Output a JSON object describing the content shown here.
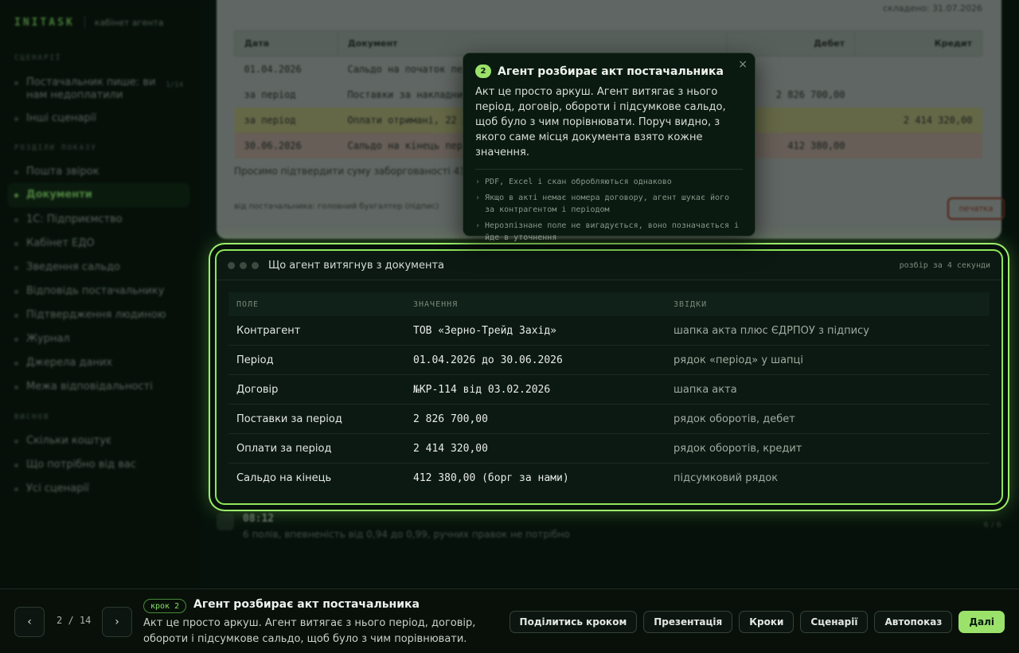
{
  "sidebar": {
    "brand": "INITASK",
    "brand_sub": "кабінет агента",
    "sections": [
      "СЦЕНАРІЇ",
      "РОЗДІЛИ ПОКАЗУ",
      "ВИСНОВ"
    ],
    "scenario_items": [
      {
        "label": "Постачальник пише: ви нам недоплатили",
        "count": "1/14"
      },
      {
        "label": "Інші сценарії"
      }
    ],
    "show_items": [
      {
        "label": "Пошта звірок"
      },
      {
        "label": "Документи",
        "active": true
      },
      {
        "label": "1С: Підприємство"
      },
      {
        "label": "Кабінет ЕДО"
      },
      {
        "label": "Зведення сальдо"
      },
      {
        "label": "Відповідь постачальнику"
      },
      {
        "label": "Підтвердження людиною"
      },
      {
        "label": "Журнал"
      },
      {
        "label": "Джерела даних"
      },
      {
        "label": "Межа відповідальності"
      }
    ],
    "conclusion_items": [
      {
        "label": "Скільки коштує"
      },
      {
        "label": "Що потрібно від вас"
      },
      {
        "label": "Усі сценарії"
      }
    ]
  },
  "document": {
    "composed": "складено: 31.07.2026",
    "headers": [
      "Дата",
      "Документ",
      "Дебет",
      "Кредит"
    ],
    "rows": [
      {
        "date": "01.04.2026",
        "doc": "Сальдо на початок періоду",
        "debit": "",
        "credit": ""
      },
      {
        "date": "за період",
        "doc": "Поставки за накладними",
        "debit": "2 826 700,00",
        "credit": ""
      },
      {
        "date": "за період",
        "doc": "Оплати отримані, 22 документи",
        "debit": "",
        "credit": "2 414 320,00"
      },
      {
        "date": "30.06.2026",
        "doc": "Сальдо на кінець періоду",
        "debit": "412 380,00",
        "credit": ""
      }
    ],
    "note": "Просимо підтвердити суму заборгованості 41… протягом 5 робочих днів.",
    "signature": "від постачальника: головний бухгалтер (підпис)",
    "stamp": "печатка"
  },
  "panel": {
    "title": "Що агент витягнув з документа",
    "meta": "розбір за 4 секунди",
    "columns": [
      "ПОЛЕ",
      "ЗНАЧЕННЯ",
      "ЗВІДКИ"
    ],
    "rows": [
      {
        "field": "Контрагент",
        "value": "ТОВ «Зерно-Трейд Захід»",
        "source": "шапка акта плюс ЄДРПОУ з підпису"
      },
      {
        "field": "Період",
        "value": "01.04.2026 до 30.06.2026",
        "source": "рядок «період» у шапці"
      },
      {
        "field": "Договір",
        "value": "№КР-114 від 03.02.2026",
        "source": "шапка акта"
      },
      {
        "field": "Поставки за період",
        "value": "2 826 700,00",
        "source": "рядок оборотів, дебет"
      },
      {
        "field": "Оплати за період",
        "value": "2 414 320,00",
        "source": "рядок оборотів, кредит"
      },
      {
        "field": "Сальдо на кінець",
        "value": "412 380,00 (борг за нами)",
        "source": "підсумковий рядок"
      }
    ]
  },
  "timeline": {
    "time": "08:12",
    "desc": "6 полів, впевненість від 0,94 до 0,99, ручних правок не потрібно",
    "tag": "6 / 6"
  },
  "popover": {
    "number": "2",
    "title": "Агент розбирає акт постачальника",
    "body": "Акт це просто аркуш. Агент витягає з нього період, договір, обороти і підсумкове сальдо, щоб було з чим порівнювати. Поруч видно, з якого саме місця документа взято кожне значення.",
    "bullets": [
      "PDF, Excel і скан обробляються однаково",
      "Якщо в акті немає номера договору, агент шукає його за контрагентом і періодом",
      "Нерозпізнане поле не вигадується, воно позначається і йде в уточнення"
    ],
    "close": "×"
  },
  "bottom": {
    "prev": "‹",
    "next": "›",
    "counter": "2 / 14",
    "step_tag": "крок 2",
    "step_title": "Агент розбирає акт постачальника",
    "step_desc": "Акт це просто аркуш. Агент витягає з нього період, договір, обороти і підсумкове сальдо, щоб було з чим порівнювати. Поруч…",
    "actions": [
      "Поділитись кроком",
      "Презентація",
      "Кроки",
      "Сценарії",
      "Автопоказ",
      "Далі"
    ]
  },
  "colors": {
    "accent": "#9be26a",
    "background": "#06110b",
    "panel": "#0b1912"
  }
}
